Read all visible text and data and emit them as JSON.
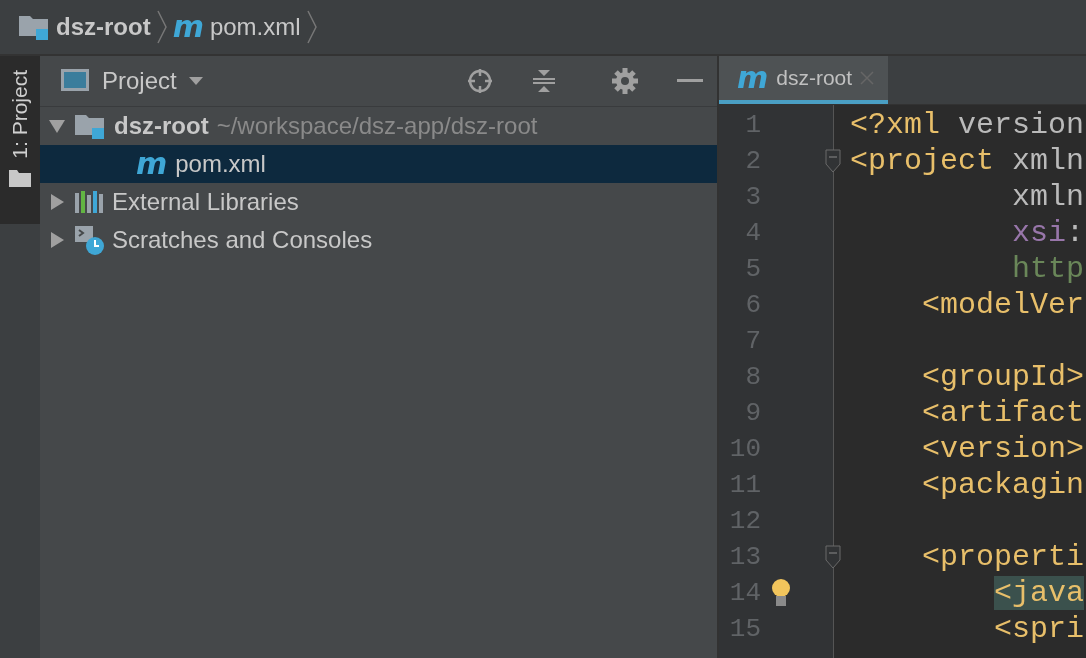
{
  "breadcrumbs": [
    {
      "kind": "module",
      "label": "dsz-root"
    },
    {
      "kind": "maven",
      "badge": "m",
      "label": "pom.xml"
    }
  ],
  "tool_stripe": {
    "label": "1: Project",
    "selected": true
  },
  "project_panel": {
    "title": "Project",
    "tree": [
      {
        "kind": "module",
        "label": "dsz-root",
        "path": "~/workspace/dsz-app/dsz-root",
        "expanded": true,
        "selected": false,
        "children": [
          {
            "kind": "maven",
            "badge": "m",
            "label": "pom.xml",
            "selected": true
          }
        ]
      },
      {
        "kind": "libraries",
        "label": "External Libraries",
        "expanded": false,
        "selected": false
      },
      {
        "kind": "scratches",
        "label": "Scratches and Consoles",
        "expanded": false,
        "selected": false
      }
    ]
  },
  "editor": {
    "tabs": [
      {
        "badge": "m",
        "label": "dsz-root",
        "selected": true
      }
    ],
    "lines": [
      {
        "number": "1",
        "fold": false,
        "bulb": false,
        "segments": [
          {
            "kind": "tag",
            "text": "<?xml"
          },
          {
            "kind": "attr",
            "text": " version"
          }
        ]
      },
      {
        "number": "2",
        "fold": true,
        "bulb": false,
        "segments": [
          {
            "kind": "tag",
            "text": "<project"
          },
          {
            "kind": "attr",
            "text": " xmln"
          }
        ]
      },
      {
        "number": "3",
        "fold": false,
        "bulb": false,
        "segments": [
          {
            "kind": "attr",
            "text": "         xmln"
          }
        ]
      },
      {
        "number": "4",
        "fold": false,
        "bulb": false,
        "segments": [
          {
            "kind": "ns",
            "text": "         xsi"
          },
          {
            "kind": "attr",
            "text": ":"
          }
        ]
      },
      {
        "number": "5",
        "fold": false,
        "bulb": false,
        "segments": [
          {
            "kind": "url",
            "text": "         http"
          }
        ]
      },
      {
        "number": "6",
        "fold": false,
        "bulb": false,
        "segments": [
          {
            "kind": "tag",
            "text": "    <modelVer"
          }
        ]
      },
      {
        "number": "7",
        "fold": false,
        "bulb": false
      },
      {
        "number": "8",
        "fold": false,
        "bulb": false,
        "segments": [
          {
            "kind": "tag",
            "text": "    <groupId>"
          }
        ]
      },
      {
        "number": "9",
        "fold": false,
        "bulb": false,
        "segments": [
          {
            "kind": "tag",
            "text": "    <artifact"
          }
        ]
      },
      {
        "number": "10",
        "fold": false,
        "bulb": false,
        "segments": [
          {
            "kind": "tag",
            "text": "    <version>"
          }
        ]
      },
      {
        "number": "11",
        "fold": false,
        "bulb": false,
        "segments": [
          {
            "kind": "tag",
            "text": "    <packagin"
          }
        ]
      },
      {
        "number": "12",
        "fold": false,
        "bulb": false
      },
      {
        "number": "13",
        "fold": true,
        "bulb": false,
        "segments": [
          {
            "kind": "tag",
            "text": "    <properti"
          }
        ]
      },
      {
        "number": "14",
        "fold": false,
        "bulb": true,
        "segments": [
          {
            "kind": "matched",
            "text": "        <java"
          }
        ]
      },
      {
        "number": "15",
        "fold": false,
        "bulb": false,
        "segments": [
          {
            "kind": "tag",
            "text": "        <spri"
          }
        ]
      }
    ]
  }
}
